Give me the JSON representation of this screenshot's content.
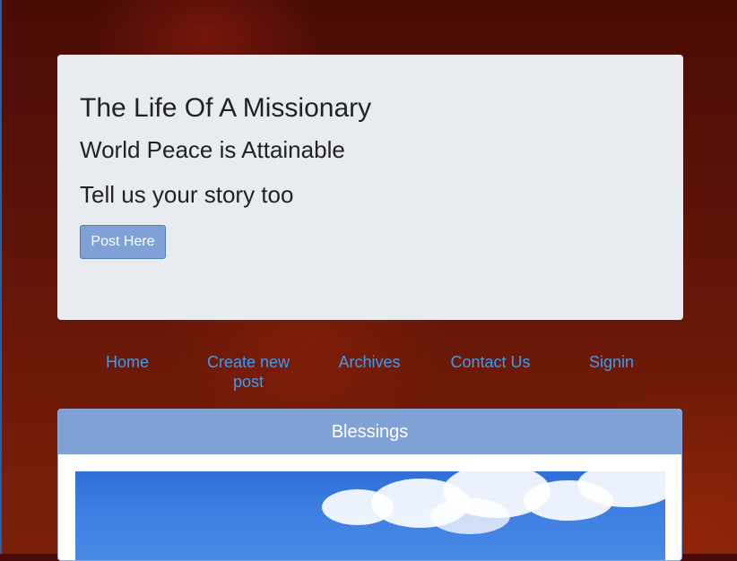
{
  "hero": {
    "title": "The Life Of A Missionary",
    "tagline": "World Peace is Attainable",
    "cta_text": "Tell us your story too",
    "button_label": "Post Here"
  },
  "nav": {
    "items": [
      {
        "label": "Home"
      },
      {
        "label": "Create new post"
      },
      {
        "label": "Archives"
      },
      {
        "label": "Contact Us"
      },
      {
        "label": "Signin"
      }
    ]
  },
  "card": {
    "header": "Blessings"
  },
  "colors": {
    "accent": "#7fa1d6",
    "link": "#3a9cf2",
    "hero_bg": "#e8ebef"
  }
}
